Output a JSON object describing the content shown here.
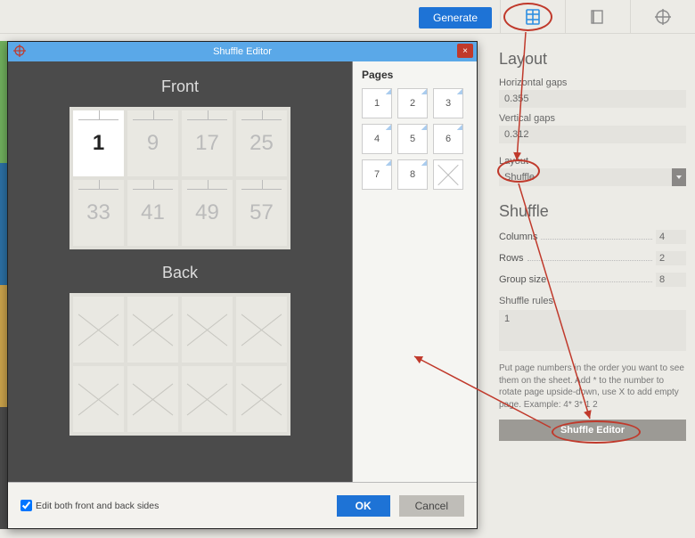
{
  "topbar": {
    "generate_label": "Generate",
    "icons": {
      "layout": "layout-icon",
      "trim": "trim-icon",
      "crop": "crop-icon"
    }
  },
  "panel": {
    "layout_heading": "Layout",
    "hgap_label": "Horizontal gaps",
    "hgap_value": "0.355",
    "vgap_label": "Vertical gaps",
    "vgap_value": "0.312",
    "layout_label": "Layout",
    "layout_value": "Shuffle",
    "shuffle_heading": "Shuffle",
    "columns_label": "Columns",
    "columns_value": "4",
    "rows_label": "Rows",
    "rows_value": "2",
    "group_label": "Group size",
    "group_value": "8",
    "rules_label": "Shuffle rules",
    "rules_value": "1",
    "help_text": "Put page numbers in the order you want to see them on the sheet. Add * to the number to rotate page upside-down, use X to add empty page. Example: 4* 3* 1 2",
    "shuffle_editor_btn": "Shuffle Editor"
  },
  "dialog": {
    "title": "Shuffle Editor",
    "close_x": "×",
    "pages_heading": "Pages",
    "page_thumbs": [
      "1",
      "2",
      "3",
      "4",
      "5",
      "6",
      "7",
      "8",
      "X"
    ],
    "front_heading": "Front",
    "front_cells": [
      "1",
      "9",
      "17",
      "25",
      "33",
      "41",
      "49",
      "57"
    ],
    "back_heading": "Back",
    "checkbox_label": "Edit both front and back sides",
    "checkbox_checked": true,
    "ok_label": "OK",
    "cancel_label": "Cancel"
  }
}
